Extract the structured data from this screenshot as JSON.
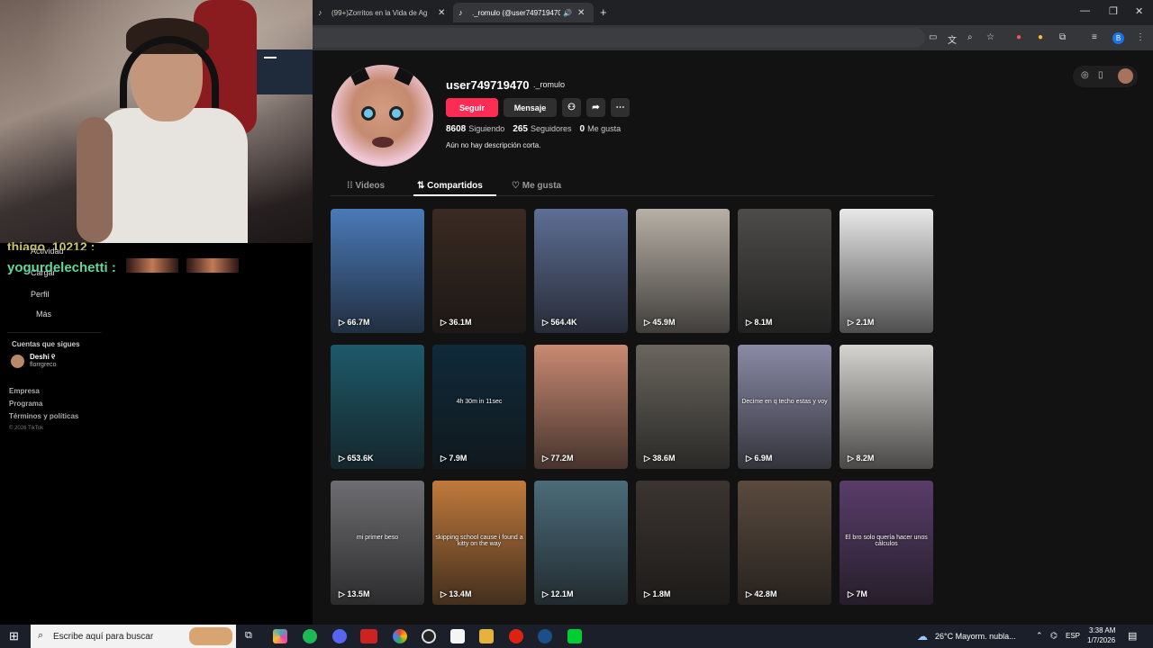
{
  "tabs": [
    {
      "title": "(99+)Zorritos en la Vida de Ag",
      "icon": "tiktok-icon"
    },
    {
      "title": "._romulo (@user749719470",
      "icon": "tiktok-icon"
    }
  ],
  "chat": {
    "user1": "thiago_10212 :",
    "user2": "yogurdelechetti :"
  },
  "sidebar": {
    "nav": [
      "Actividad",
      "Cargar",
      "Perfil",
      "Más"
    ],
    "following_title": "Cuentas que sigues",
    "following": [
      {
        "name": "Deshi ୧",
        "user": "florrgreco"
      }
    ],
    "footer": [
      "Empresa",
      "Programa",
      "Términos y políticas"
    ],
    "copyright": "© 2026 TikTok"
  },
  "profile": {
    "username": "user749719470",
    "nickname": "._romulo",
    "follow_label": "Seguir",
    "message_label": "Mensaje",
    "stats": [
      {
        "value": "8608",
        "label": "Siguiendo"
      },
      {
        "value": "265",
        "label": "Seguidores"
      },
      {
        "value": "0",
        "label": "Me gusta"
      }
    ],
    "bio": "Aún no hay descripción corta.",
    "tabs": [
      {
        "label": "Videos",
        "icon": "grid-icon"
      },
      {
        "label": "Compartidos",
        "icon": "repost-icon"
      },
      {
        "label": "Me gusta",
        "icon": "heart-icon"
      }
    ],
    "active_tab": "Compartidos"
  },
  "videos": [
    {
      "views": "66.7M",
      "caption": "",
      "color": "#4a7ab8"
    },
    {
      "views": "36.1M",
      "caption": "",
      "color": "#3a2a22"
    },
    {
      "views": "564.4K",
      "caption": "",
      "color": "#5e6e95"
    },
    {
      "views": "45.9M",
      "caption": "",
      "color": "#b8b0a6"
    },
    {
      "views": "8.1M",
      "caption": "",
      "color": "#4d4b4a"
    },
    {
      "views": "2.1M",
      "caption": "",
      "color": "#e8e8e8"
    },
    {
      "views": "653.6K",
      "caption": "",
      "color": "#1d5a6a"
    },
    {
      "views": "7.9M",
      "caption": "4h 30m in 11sec",
      "color": "#0f2a3a"
    },
    {
      "views": "77.2M",
      "caption": "",
      "color": "#c98a72"
    },
    {
      "views": "38.6M",
      "caption": "",
      "color": "#6a665e"
    },
    {
      "views": "6.9M",
      "caption": "Decime en q techo estas y voy",
      "color": "#8a8aa6"
    },
    {
      "views": "8.2M",
      "caption": "",
      "color": "#d6d4cf"
    },
    {
      "views": "13.5M",
      "caption": "mi primer beso",
      "color": "#6e6e72"
    },
    {
      "views": "13.4M",
      "caption": "skipping school cause i found a kitty on the way",
      "color": "#c07a3c"
    },
    {
      "views": "12.1M",
      "caption": "",
      "color": "#4b6c7a"
    },
    {
      "views": "1.8M",
      "caption": "",
      "color": "#3b3430"
    },
    {
      "views": "42.8M",
      "caption": "",
      "color": "#5a4a3e"
    },
    {
      "views": "7M",
      "caption": "El bro solo quería hacer unos cálculos",
      "color": "#5a3d6a"
    }
  ],
  "taskbar": {
    "search_placeholder": "Escribe aquí para buscar",
    "weather": "26°C  Mayorm. nubla...",
    "lang": "ESP",
    "time": "3:38 AM",
    "date": "1/7/2026"
  }
}
